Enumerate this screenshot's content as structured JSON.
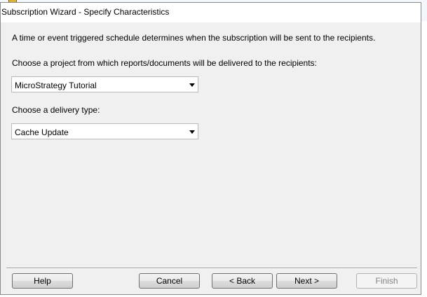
{
  "window": {
    "title": "Subscription Wizard - Specify Characteristics"
  },
  "content": {
    "intro": "A time or event triggered schedule determines when the subscription will be sent to the recipients.",
    "project_label": "Choose a project from which reports/documents will be delivered to the recipients:",
    "project_value": "MicroStrategy Tutorial",
    "delivery_label": "Choose a delivery type:",
    "delivery_value": "Cache Update"
  },
  "buttons": {
    "help": "Help",
    "cancel": "Cancel",
    "back": "< Back",
    "next": "Next >",
    "finish": "Finish"
  }
}
